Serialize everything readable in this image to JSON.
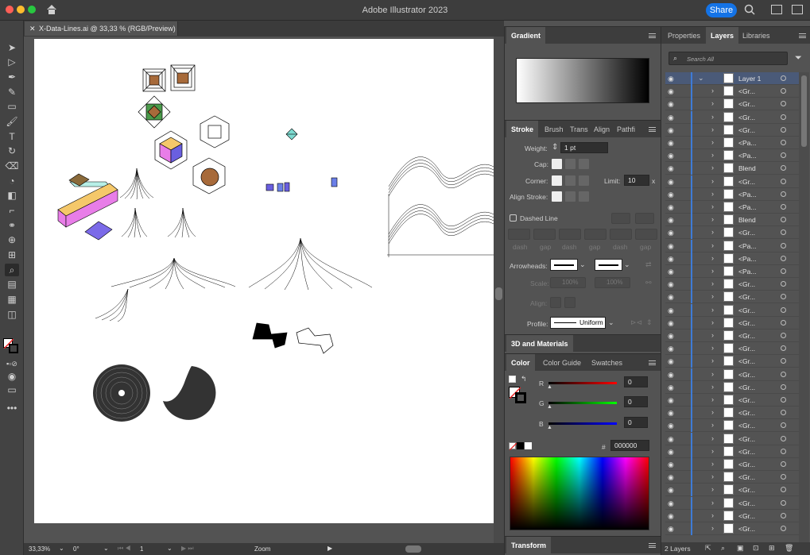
{
  "window": {
    "title": "Adobe Illustrator 2023",
    "share_label": "Share"
  },
  "document": {
    "tab_label": "X-Data-Lines.ai @ 33,33 % (RGB/Preview)"
  },
  "status": {
    "zoom": "33,33%",
    "rotation": "0°",
    "artboard_num": "1",
    "tool_name": "Zoom"
  },
  "gradient_panel": {
    "title": "Gradient"
  },
  "stroke_panel": {
    "tabs": [
      "Stroke",
      "Brush",
      "Trans",
      "Align",
      "Pathfi"
    ],
    "weight_label": "Weight:",
    "weight_value": "1 pt",
    "cap_label": "Cap:",
    "corner_label": "Corner:",
    "limit_label": "Limit:",
    "limit_value": "10",
    "limit_unit": "x",
    "align_label": "Align Stroke:",
    "dashed_label": "Dashed Line",
    "dash_labels": [
      "dash",
      "gap",
      "dash",
      "gap",
      "dash",
      "gap"
    ],
    "arrowheads_label": "Arrowheads:",
    "scale_label": "Scale:",
    "scale_a": "100%",
    "scale_b": "100%",
    "align_arrows_label": "Align:",
    "profile_label": "Profile:",
    "profile_value": "Uniform"
  },
  "materials_panel": {
    "title": "3D and Materials"
  },
  "color_panel": {
    "tabs": [
      "Color",
      "Color Guide",
      "Swatches"
    ],
    "r_label": "R",
    "g_label": "G",
    "b_label": "B",
    "r_value": "0",
    "g_value": "0",
    "b_value": "0",
    "hex_label": "#",
    "hex_value": "000000"
  },
  "transform_panel": {
    "title": "Transform"
  },
  "layers_panel": {
    "tabs": [
      "Properties",
      "Layers",
      "Libraries"
    ],
    "search_placeholder": "Search All",
    "footer_count": "2 Layers",
    "rows": [
      {
        "name": "Layer 1"
      },
      {
        "name": "<Gr..."
      },
      {
        "name": "<Gr..."
      },
      {
        "name": "<Gr..."
      },
      {
        "name": "<Gr..."
      },
      {
        "name": "<Pa..."
      },
      {
        "name": "<Pa..."
      },
      {
        "name": "Blend"
      },
      {
        "name": "<Gr..."
      },
      {
        "name": "<Pa..."
      },
      {
        "name": "<Pa..."
      },
      {
        "name": "Blend"
      },
      {
        "name": "<Gr..."
      },
      {
        "name": "<Pa..."
      },
      {
        "name": "<Pa..."
      },
      {
        "name": "<Pa..."
      },
      {
        "name": "<Gr..."
      },
      {
        "name": "<Gr..."
      },
      {
        "name": "<Gr..."
      },
      {
        "name": "<Gr..."
      },
      {
        "name": "<Gr..."
      },
      {
        "name": "<Gr..."
      },
      {
        "name": "<Gr..."
      },
      {
        "name": "<Gr..."
      },
      {
        "name": "<Gr..."
      },
      {
        "name": "<Gr..."
      },
      {
        "name": "<Gr..."
      },
      {
        "name": "<Gr..."
      },
      {
        "name": "<Gr..."
      },
      {
        "name": "<Gr..."
      },
      {
        "name": "<Gr..."
      },
      {
        "name": "<Gr..."
      },
      {
        "name": "<Gr..."
      },
      {
        "name": "<Gr..."
      },
      {
        "name": "<Gr..."
      },
      {
        "name": "<Gr..."
      }
    ]
  },
  "colors": {
    "accent": "#1473e6",
    "layer_bar": "#3e7bd6"
  }
}
